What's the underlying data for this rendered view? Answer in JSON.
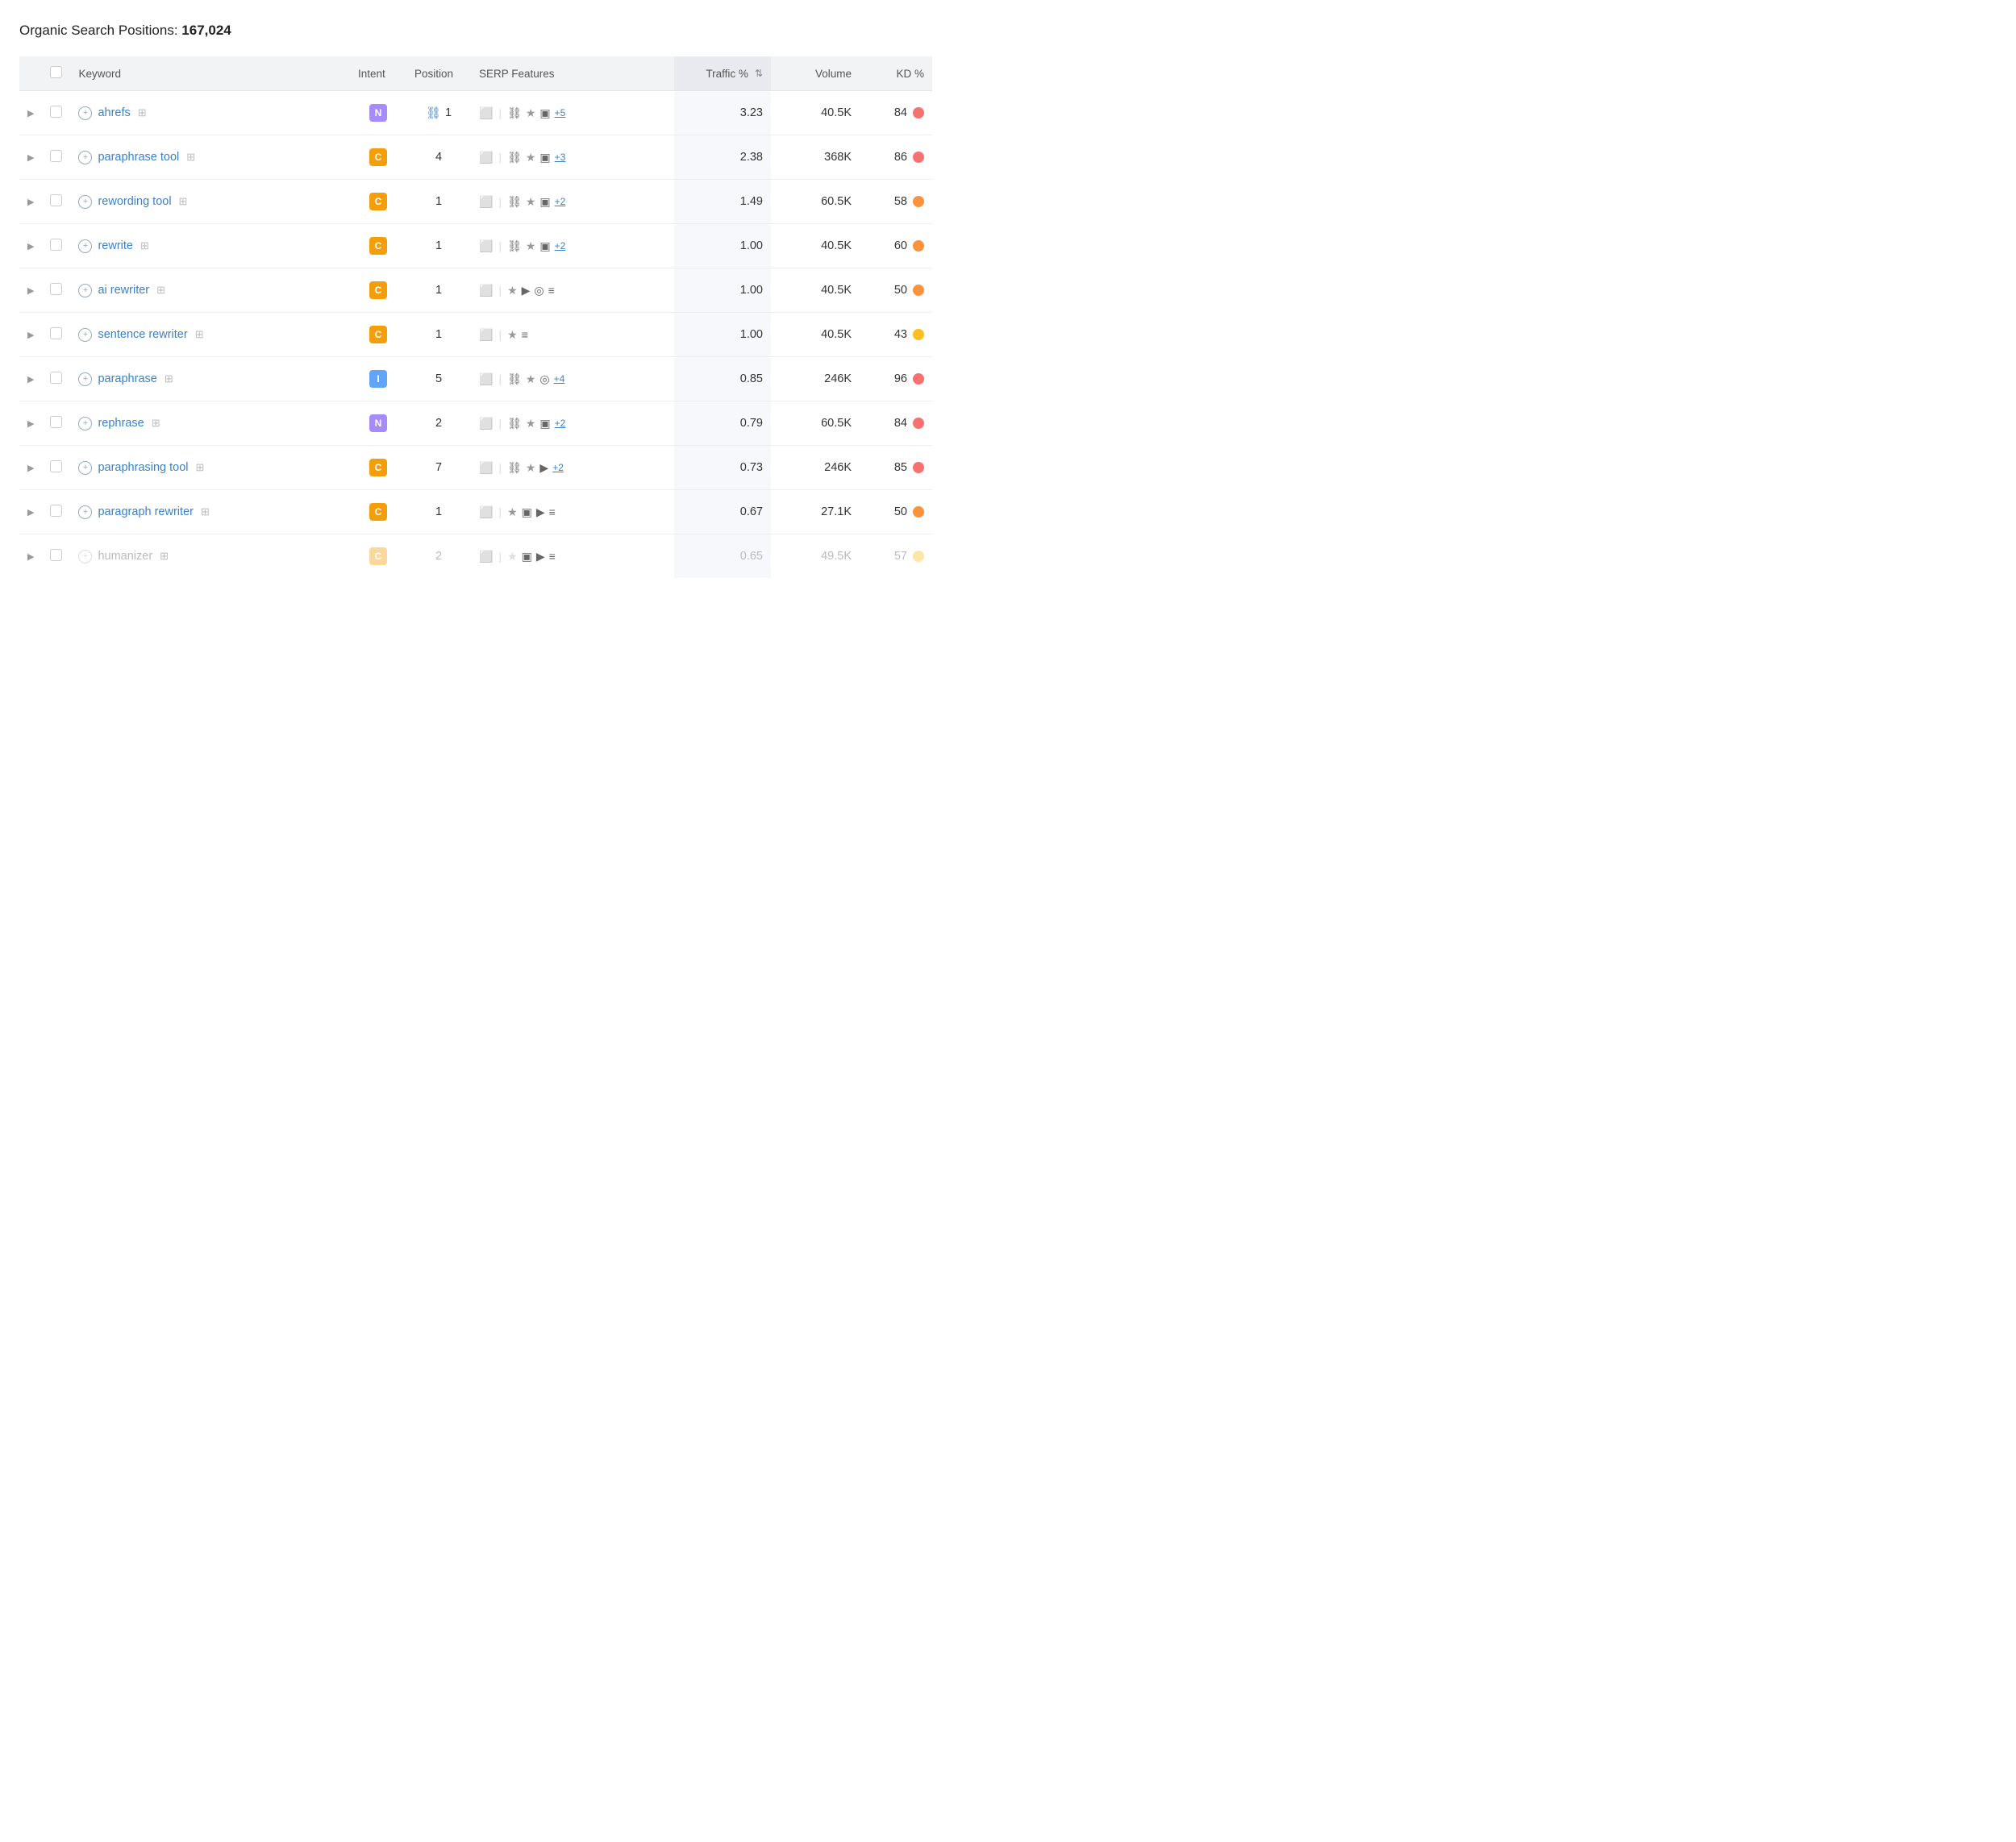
{
  "header": {
    "title": "Organic Search Positions:",
    "count": "167,024"
  },
  "columns": {
    "keyword": "Keyword",
    "intent": "Intent",
    "position": "Position",
    "serp": "SERP Features",
    "traffic": "Traffic %",
    "volume": "Volume",
    "kd": "KD %"
  },
  "rows": [
    {
      "keyword": "ahrefs",
      "intent": "N",
      "intentClass": "intent-n",
      "position": "1",
      "hasLink": true,
      "serp": [
        "📷",
        "|",
        "🔗",
        "⭐",
        "🖼",
        "+5"
      ],
      "traffic": "3.23",
      "volume": "40.5K",
      "kd": "84",
      "kdColor": "#f87171",
      "faded": false
    },
    {
      "keyword": "paraphrase tool",
      "intent": "C",
      "intentClass": "intent-c",
      "position": "4",
      "hasLink": false,
      "serp": [
        "📷",
        "|",
        "🔗",
        "⭐",
        "🖼",
        "+3"
      ],
      "traffic": "2.38",
      "volume": "368K",
      "kd": "86",
      "kdColor": "#f87171",
      "faded": false
    },
    {
      "keyword": "rewording tool",
      "intent": "C",
      "intentClass": "intent-c",
      "position": "1",
      "hasLink": false,
      "serp": [
        "📷",
        "|",
        "🔗",
        "⭐",
        "🖼",
        "+2"
      ],
      "traffic": "1.49",
      "volume": "60.5K",
      "kd": "58",
      "kdColor": "#fb923c",
      "faded": false
    },
    {
      "keyword": "rewrite",
      "intent": "C",
      "intentClass": "intent-c",
      "position": "1",
      "hasLink": false,
      "serp": [
        "📷",
        "|",
        "🔗",
        "⭐",
        "🖼",
        "+2"
      ],
      "traffic": "1.00",
      "volume": "40.5K",
      "kd": "60",
      "kdColor": "#fb923c",
      "faded": false
    },
    {
      "keyword": "ai rewriter",
      "intent": "C",
      "intentClass": "intent-c",
      "position": "1",
      "hasLink": false,
      "serp": [
        "📷",
        "|",
        "⭐",
        "▶",
        "?",
        "≡"
      ],
      "traffic": "1.00",
      "volume": "40.5K",
      "kd": "50",
      "kdColor": "#fb923c",
      "faded": false
    },
    {
      "keyword": "sentence rewriter",
      "intent": "C",
      "intentClass": "intent-c",
      "position": "1",
      "hasLink": false,
      "serp": [
        "📷",
        "|",
        "⭐",
        "≡"
      ],
      "traffic": "1.00",
      "volume": "40.5K",
      "kd": "43",
      "kdColor": "#fbbf24",
      "faded": false
    },
    {
      "keyword": "paraphrase",
      "intent": "I",
      "intentClass": "intent-i",
      "position": "5",
      "hasLink": false,
      "serp": [
        "📷",
        "|",
        "🔗",
        "⭐",
        "?",
        "+4"
      ],
      "traffic": "0.85",
      "volume": "246K",
      "kd": "96",
      "kdColor": "#f87171",
      "faded": false
    },
    {
      "keyword": "rephrase",
      "intent": "N",
      "intentClass": "intent-n",
      "position": "2",
      "hasLink": false,
      "serp": [
        "📷",
        "|",
        "🔗",
        "⭐",
        "🖼",
        "+2"
      ],
      "traffic": "0.79",
      "volume": "60.5K",
      "kd": "84",
      "kdColor": "#f87171",
      "faded": false
    },
    {
      "keyword": "paraphrasing tool",
      "intent": "C",
      "intentClass": "intent-c",
      "position": "7",
      "hasLink": false,
      "serp": [
        "📷",
        "|",
        "🔗",
        "⭐",
        "▶",
        "+2"
      ],
      "traffic": "0.73",
      "volume": "246K",
      "kd": "85",
      "kdColor": "#f87171",
      "faded": false
    },
    {
      "keyword": "paragraph rewriter",
      "intent": "C",
      "intentClass": "intent-c",
      "position": "1",
      "hasLink": false,
      "serp": [
        "📷",
        "|",
        "⭐",
        "🖼",
        "▶",
        "≡"
      ],
      "traffic": "0.67",
      "volume": "27.1K",
      "kd": "50",
      "kdColor": "#fb923c",
      "faded": false
    },
    {
      "keyword": "humanizer",
      "intent": "C",
      "intentClass": "intent-c",
      "position": "2",
      "hasLink": false,
      "serp": [
        "📷",
        "|",
        "⭐",
        "🖼",
        "▶",
        "≡"
      ],
      "traffic": "0.65",
      "volume": "49.5K",
      "kd": "57",
      "kdColor": "#fbbf24",
      "faded": true
    }
  ]
}
